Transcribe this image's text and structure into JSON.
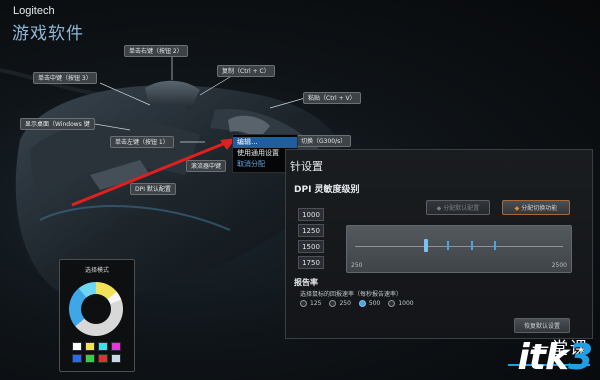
{
  "brand": "Logitech",
  "subtitle": "游戏软件",
  "callouts": {
    "middle_button": "单击中键（按钮 3）",
    "right_button": "单击右键（按钮 2）",
    "copy": "复制（Ctrl + C）",
    "paste": "粘贴（Ctrl + V）",
    "show_desktop": "显示桌面（Windows 键",
    "left_button": "单击左键（按钮 1）",
    "dpi_switch": "切换（G300/s）",
    "scroll_mid": "滚流器中键",
    "dpi_default": "DPI 默认配置"
  },
  "context_menu": {
    "items": [
      "编辑...",
      "使用通用设置",
      "取消分配"
    ],
    "highlighted_index": 0
  },
  "panel": {
    "title": "针设置",
    "dpi_section": "DPI 灵敏度级别",
    "assign_default_btn": "分配默认配置",
    "assign_switch_btn": "分配切换功能",
    "dpi_levels": [
      "1000",
      "1250",
      "1500",
      "1750"
    ],
    "slider_min": "250",
    "slider_max": "2500",
    "slider_ticks": [
      1000,
      1250,
      1500,
      1750
    ],
    "slider_active_tick": 1000,
    "report_rate_title": "报告率",
    "report_rate_desc": "选择鼠标的回报速率（每秒报告速率）",
    "report_rates": [
      "125",
      "250",
      "500",
      "1000"
    ],
    "selected_rate": "500",
    "restore_btn": "恢复默认设置"
  },
  "mode_box": {
    "title": "选择模式",
    "swatches": [
      "#ffffff",
      "#f2e25a",
      "#3fe0e8",
      "#e23ad8",
      "#2b6be8",
      "#2fd04a",
      "#e23030",
      "#c9d9e8"
    ]
  },
  "watermark": {
    "text_main": "itk",
    "text_accent": "3",
    "text_cn": "一堂课"
  },
  "colors": {
    "accent": "#4aa6e0",
    "arrow": "#e02020"
  }
}
